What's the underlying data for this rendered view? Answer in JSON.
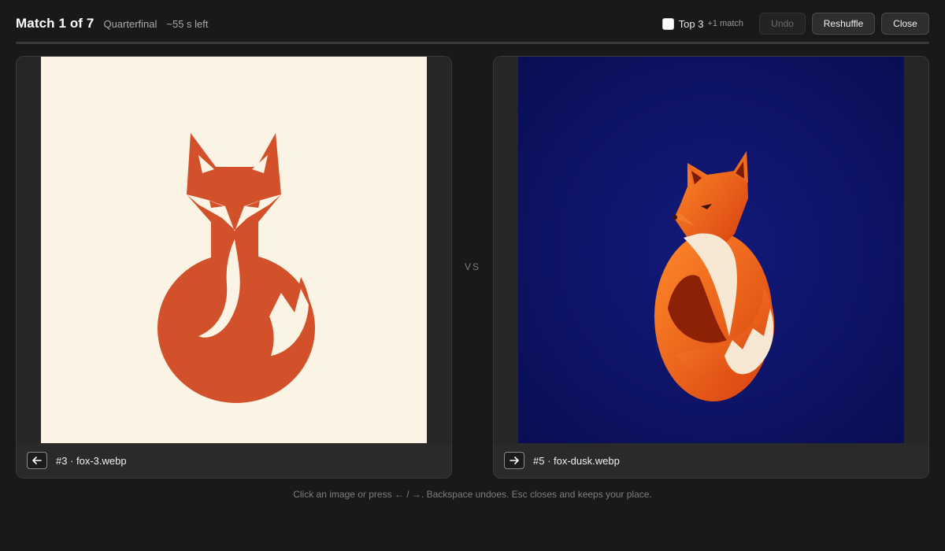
{
  "header": {
    "title": "Match 1 of 7",
    "round": "Quarterfinal",
    "timer": "~55 s left",
    "top3_label": "Top 3",
    "top3_note": "+1 match",
    "top3_checked": false,
    "undo_label": "Undo",
    "reshuffle_label": "Reshuffle",
    "close_label": "Close"
  },
  "vs_label": "VS",
  "cards": [
    {
      "caption": "#3 · fox-3.webp",
      "key_icon": "arrow-left-icon",
      "background_color": "#fbf4e4",
      "fox_color": "#d2512b"
    },
    {
      "caption": "#5 · fox-dusk.webp",
      "key_icon": "arrow-right-icon",
      "background_color": "#0b0f5c",
      "fox_color": "#f06a1e"
    }
  ],
  "hint": "Click an image or press ← / →. Backspace undoes. Esc closes and keeps your place."
}
